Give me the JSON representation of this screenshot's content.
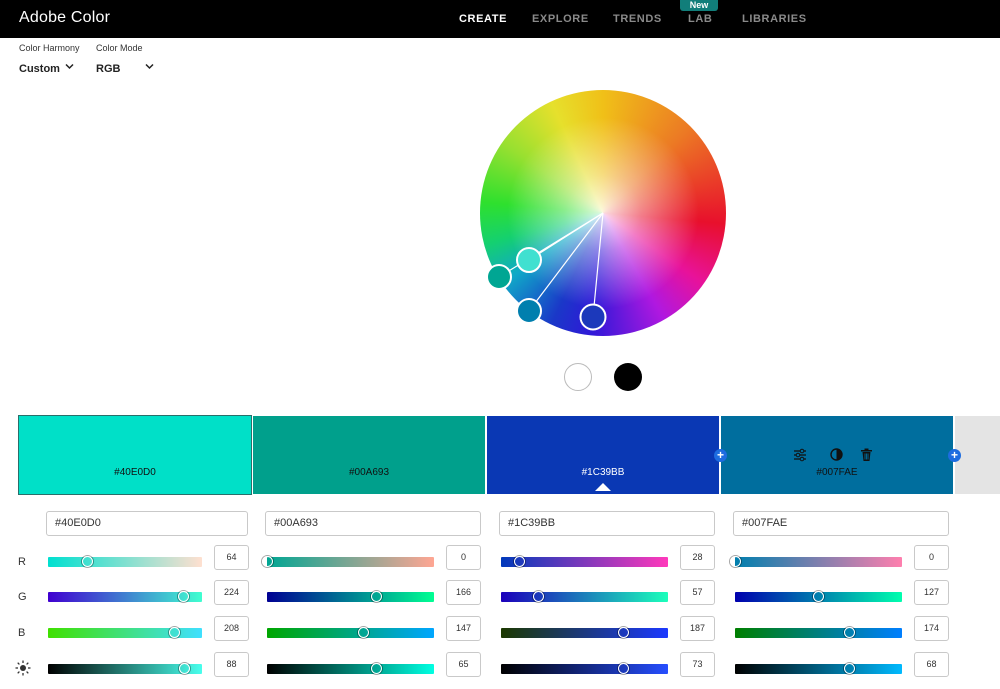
{
  "app": {
    "title": "Adobe Color"
  },
  "nav": [
    {
      "label": "CREATE",
      "active": true
    },
    {
      "label": "EXPLORE",
      "active": false
    },
    {
      "label": "TRENDS",
      "active": false
    },
    {
      "label": "LAB",
      "active": false,
      "badge": "New"
    },
    {
      "label": "LIBRARIES",
      "active": false
    }
  ],
  "controls": {
    "harmony_label": "Color Harmony",
    "harmony_value": "Custom",
    "mode_label": "Color Mode",
    "mode_value": "RGB"
  },
  "wheel": {
    "handles": [
      {
        "color": "#00A693"
      },
      {
        "color": "#40E0D0"
      },
      {
        "color": "#007FAE"
      },
      {
        "color": "#1C39BB"
      }
    ]
  },
  "extras": {
    "white": "#FFFFFF",
    "black": "#000000"
  },
  "row_labels": [
    "R",
    "G",
    "B"
  ],
  "brightness_icon": "sun-icon",
  "tools": [
    "sliders-icon",
    "contrast-icon",
    "trash-icon"
  ],
  "swatches": [
    {
      "hex": "#40E0D0",
      "bg": "#00E0C8",
      "text": "#111111",
      "r": 64,
      "g": 224,
      "b": 208,
      "brightness": 88
    },
    {
      "hex": "#00A693",
      "bg": "#00A08C",
      "text": "#111111",
      "r": 0,
      "g": 166,
      "b": 147,
      "brightness": 65
    },
    {
      "hex": "#1C39BB",
      "bg": "#0A38B4",
      "text": "#FFFFFF",
      "r": 28,
      "g": 57,
      "b": 187,
      "brightness": 73
    },
    {
      "hex": "#007FAE",
      "bg": "#006E9E",
      "text": "#111111",
      "r": 0,
      "g": 127,
      "b": 174,
      "brightness": 68
    }
  ]
}
